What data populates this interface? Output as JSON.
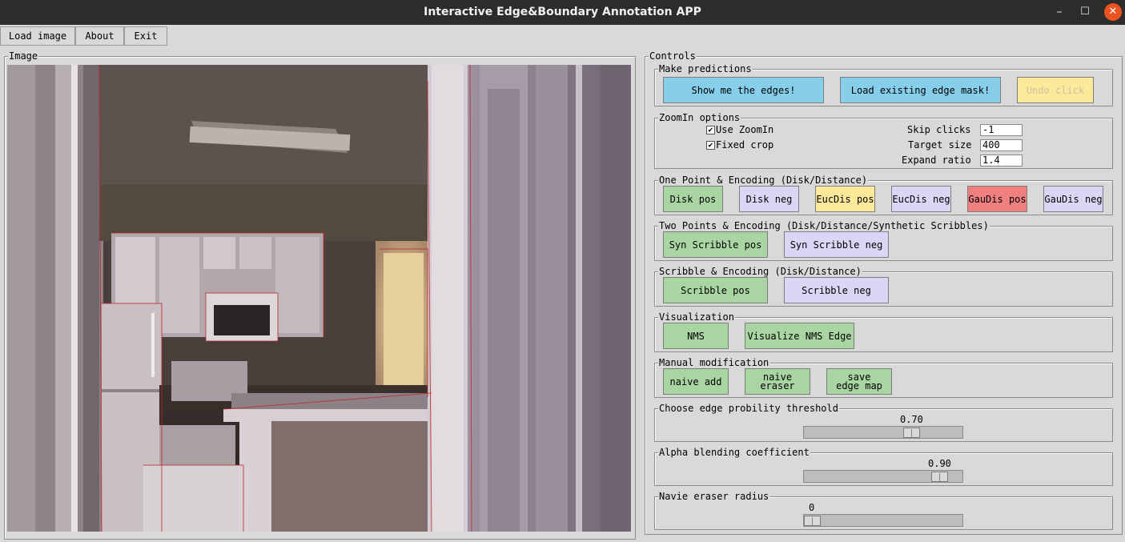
{
  "window": {
    "title": "Interactive Edge&Boundary Annotation APP",
    "minimize": "–",
    "maximize": "☐",
    "close": "✕"
  },
  "menu": {
    "load_image": "Load image",
    "about": "About",
    "exit": "Exit"
  },
  "image_frame": {
    "title": "Image"
  },
  "controls": {
    "title": "Controls",
    "predictions": {
      "title": "Make predictions",
      "show_edges": "Show me the edges!",
      "load_mask": "Load existing edge mask!",
      "undo": "Undo click"
    },
    "zoomin": {
      "title": "ZoomIn options",
      "use_zoomin": "Use ZoomIn",
      "use_zoomin_checked": true,
      "fixed_crop": "Fixed crop",
      "fixed_crop_checked": true,
      "skip_clicks_label": "Skip clicks",
      "skip_clicks": "-1",
      "target_size_label": "Target size",
      "target_size": "400",
      "expand_ratio_label": "Expand ratio",
      "expand_ratio": "1.4"
    },
    "one_point": {
      "title": "One Point & Encoding (Disk/Distance)",
      "disk_pos": "Disk pos",
      "disk_neg": "Disk neg",
      "eucdis_pos": "EucDis pos",
      "eucdis_neg": "EucDis neg",
      "gaudis_pos": "GauDis pos",
      "gaudis_neg": "GauDis neg"
    },
    "two_points": {
      "title": "Two Points & Encoding (Disk/Distance/Synthetic Scribbles)",
      "syn_pos": "Syn Scribble pos",
      "syn_neg": "Syn Scribble neg"
    },
    "scribble": {
      "title": "Scribble & Encoding (Disk/Distance)",
      "pos": "Scribble pos",
      "neg": "Scribble neg"
    },
    "visualization": {
      "title": "Visualization",
      "nms": "NMS",
      "vis_nms": "Visualize NMS Edge"
    },
    "manual": {
      "title": "Manual modification",
      "naive_add": "naive add",
      "naive_eraser": "naive\neraser",
      "save_map": "save\nedge map"
    },
    "threshold": {
      "title": "Choose edge probility threshold",
      "value": "0.70",
      "level": 0.7
    },
    "alpha": {
      "title": "Alpha blending coefficient",
      "value": "0.90",
      "level": 0.9
    },
    "eraser_radius": {
      "title": "Navie eraser radius",
      "value": "0",
      "level": 0
    }
  },
  "colors": {
    "green": "#a8d5a1",
    "purple": "#ddd5f5",
    "blue": "#87ceeb",
    "yellow": "#fde99a",
    "red": "#f08080",
    "titlebar": "#2c2c2c",
    "close": "#e95420"
  }
}
